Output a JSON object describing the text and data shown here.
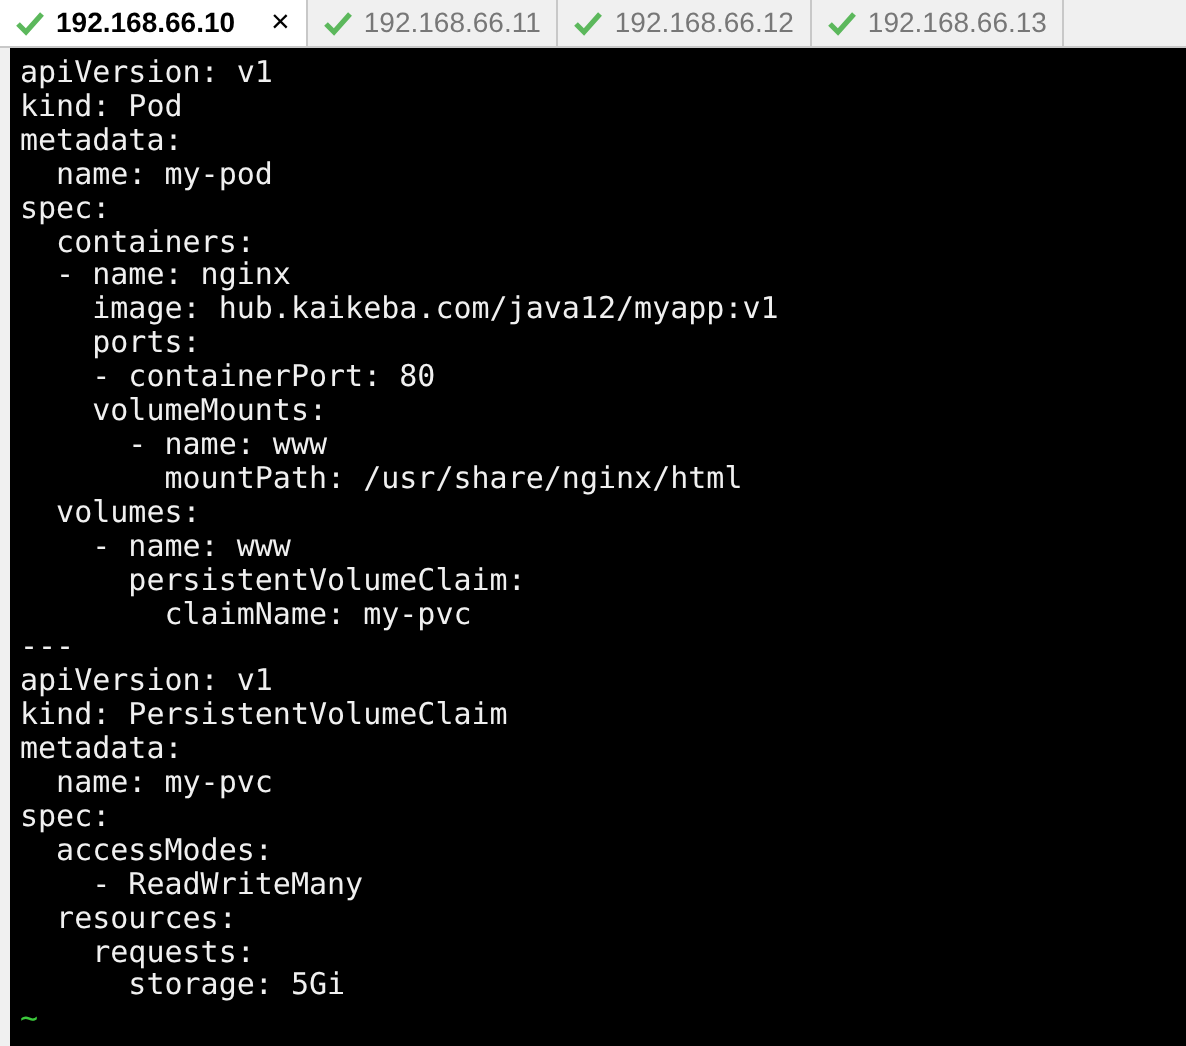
{
  "tabs": [
    {
      "label": "192.168.66.10",
      "selected": true,
      "close": "×"
    },
    {
      "label": "192.168.66.11",
      "selected": false
    },
    {
      "label": "192.168.66.12",
      "selected": false
    },
    {
      "label": "192.168.66.13",
      "selected": false
    }
  ],
  "terminal": {
    "lines": [
      "apiVersion: v1",
      "kind: Pod",
      "metadata:",
      "  name: my-pod",
      "spec:",
      "  containers:",
      "  - name: nginx",
      "    image: hub.kaikeba.com/java12/myapp:v1",
      "    ports:",
      "    - containerPort: 80",
      "    volumeMounts:",
      "      - name: www",
      "        mountPath: /usr/share/nginx/html",
      "  volumes:",
      "    - name: www",
      "      persistentVolumeClaim:",
      "        claimName: my-pvc",
      "---",
      "apiVersion: v1",
      "kind: PersistentVolumeClaim",
      "metadata:",
      "  name: my-pvc",
      "spec:",
      "  accessModes:",
      "    - ReadWriteMany",
      "  resources:",
      "    requests:",
      "      storage: 5Gi"
    ],
    "tildes": [
      "~"
    ]
  }
}
